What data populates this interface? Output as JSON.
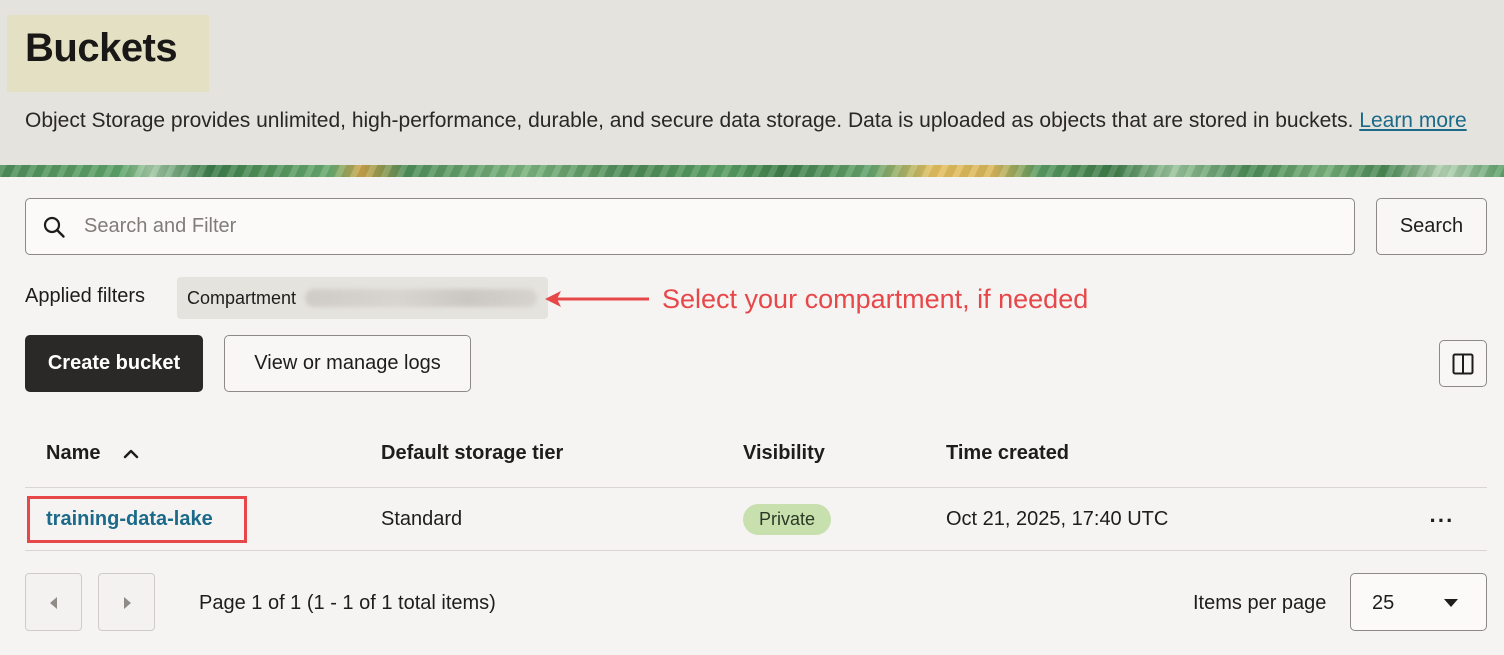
{
  "header": {
    "title": "Buckets",
    "description": "Object Storage provides unlimited, high-performance, durable, and secure data storage. Data is uploaded as objects that are stored in buckets.",
    "learn_more": "Learn more"
  },
  "search": {
    "placeholder": "Search and Filter",
    "value": "",
    "button_label": "Search"
  },
  "filters": {
    "label": "Applied filters",
    "chip_label": "Compartment"
  },
  "annotation": {
    "text": "Select your compartment, if needed",
    "color": "#e8474a"
  },
  "toolbar": {
    "create_label": "Create bucket",
    "logs_label": "View or manage logs",
    "columns_icon": "column-layout-icon"
  },
  "table": {
    "columns": [
      "Name",
      "Default storage tier",
      "Visibility",
      "Time created"
    ],
    "sort_icon": "chevron-up-icon",
    "rows": [
      {
        "name": "training-data-lake",
        "storage_tier": "Standard",
        "visibility": "Private",
        "time_created": "Oct 21, 2025, 17:40 UTC",
        "actions_label": "···"
      }
    ]
  },
  "pagination": {
    "info": "Page 1 of 1 (1 - 1 of 1 total items)",
    "items_per_page_label": "Items per page",
    "items_per_page_value": "25"
  },
  "colors": {
    "accent_link": "#1b6a89",
    "primary_button": "#2b2927",
    "badge_private": "#c8dfae"
  }
}
